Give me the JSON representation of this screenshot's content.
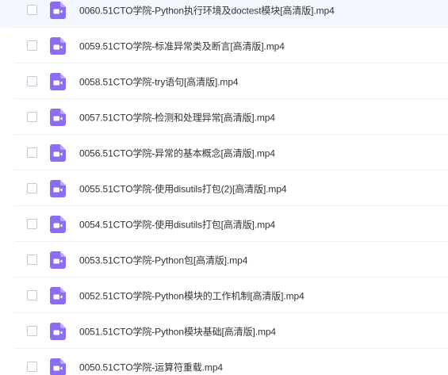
{
  "files": [
    {
      "name": "0060.51CTO学院-Python执行环境及doctest模块[高清版].mp4",
      "selected": true
    },
    {
      "name": "0059.51CTO学院-标准异常类及断言[高清版].mp4",
      "selected": false
    },
    {
      "name": "0058.51CTO学院-try语句[高清版].mp4",
      "selected": false
    },
    {
      "name": "0057.51CTO学院-检测和处理异常[高清版].mp4",
      "selected": false
    },
    {
      "name": "0056.51CTO学院-异常的基本概念[高清版].mp4",
      "selected": false
    },
    {
      "name": "0055.51CTO学院-使用disutils打包(2)[高清版].mp4",
      "selected": false
    },
    {
      "name": "0054.51CTO学院-使用disutils打包[高清版].mp4",
      "selected": false
    },
    {
      "name": "0053.51CTO学院-Python包[高清版].mp4",
      "selected": false
    },
    {
      "name": "0052.51CTO学院-Python模块的工作机制[高清版].mp4",
      "selected": false
    },
    {
      "name": "0051.51CTO学院-Python模块基础[高清版].mp4",
      "selected": false
    },
    {
      "name": "0050.51CTO学院-运算符重载.mp4",
      "selected": false
    }
  ],
  "icon": {
    "name": "video-file-icon",
    "color": "#8c6cf0"
  }
}
